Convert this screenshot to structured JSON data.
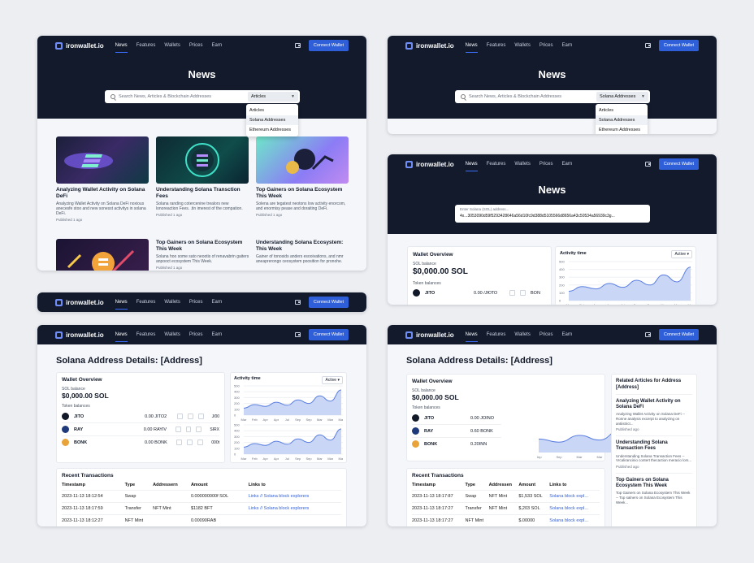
{
  "brand": "ironwallet.io",
  "nav": [
    "News",
    "Features",
    "Wallets",
    "Prices",
    "Earn"
  ],
  "connect": "Connect Wallet",
  "hero_title": "News",
  "search_placeholder": "Search News, Articles & Blockchain Addresses",
  "select_value_a": "Articles",
  "select_value_b": "Solana Addresses",
  "dropdown": [
    "Articles",
    "Solana Addresses",
    "Ethereum Addresses"
  ],
  "sol_input_placeholder": "Enter Solana (SOL) address...",
  "sol_input_value": "4x...3053090d59f5293428646a56d10fc9d388d5105566d8656a43c50534a56939c3g...",
  "articles": [
    {
      "title": "Analyzing Wallet Activity on Solana DeFi",
      "desc": "Analyzing Wallet Activity on Solana DeFi noxious anecesfe stoo and new sonesst activitys in solana DeFi.",
      "meta": "Published 1 ago"
    },
    {
      "title": "Understanding Solana Transction Fees",
      "desc": "Solana randing cotercenine trealors new lonoreaction Fees. .tin imerest of the compation.",
      "meta": "Published 1 ago"
    },
    {
      "title": "Top Gainers on Solana Ecosystem This Week",
      "desc": "Solena are tegatest neotons low activity enorcom, and enormisy pease and doraiting DeFi.",
      "meta": "Published 1 ago"
    },
    {
      "title": "Top Gainers on Solana Ecosystem This Week",
      "desc": "Solana hoo some sato neootis of renavabrin gaiters anpooct ecosystem This Week.",
      "meta": "Published 1 ago"
    },
    {
      "title": "Understanding Solana Ecosystem: This Week",
      "desc": "Gainer of tonosids anders esooivations, and nmr aneaprerongo ceosystem poosition for pronohe.",
      "meta": ""
    }
  ],
  "overview": {
    "title": "Wallet Overview",
    "sol_label": "SOL balance",
    "sol_value": "$0,000.00 SOL",
    "tokens_label": "Token balances"
  },
  "tokens_a": [
    {
      "name": "JITO",
      "amt": "0.00 JITO",
      "c": "#111827"
    }
  ],
  "tokens_c": [
    {
      "name": "JITO",
      "amt": "0.00 JITO2",
      "c": "#111827",
      "right": "J/00"
    },
    {
      "name": "RAY",
      "amt": "0.00 RAYIV",
      "c": "#1f3a7a",
      "right": "SIRX"
    },
    {
      "name": "BONK",
      "amt": "0.00 BONK",
      "c": "#e8a33a",
      "right": "000t"
    }
  ],
  "tokens_d": [
    {
      "name": "JITO",
      "amt": "0.00 JOINO",
      "c": "#111827"
    },
    {
      "name": "RAY",
      "amt": "0.60 BONK",
      "c": "#1f3a7a"
    },
    {
      "name": "BONK",
      "amt": "0.20INN",
      "c": "#e8a33a"
    }
  ],
  "tokens_b_extra": {
    "amt": "0.00 /ЈЮТО",
    "right": "BON"
  },
  "activity": {
    "title": "Activity time",
    "filter": "Active"
  },
  "chart_data": {
    "type": "area",
    "title": "Activity time",
    "x": [
      "Mar",
      "Feb",
      "Apr",
      "Apr",
      "Jul",
      "Sep",
      "Sep",
      "Mar",
      "Mar",
      "Mar"
    ],
    "yticks": [
      0,
      100,
      200,
      300,
      400,
      500
    ],
    "series": [
      {
        "values": [
          120,
          180,
          150,
          220,
          170,
          260,
          200,
          330,
          240,
          430
        ]
      }
    ]
  },
  "details_title": "Solana Address Details: [Address]",
  "recent": {
    "title": "Recent Transactions",
    "headers_c": [
      "Timestamp",
      "Type",
      "Addressern",
      "Amount",
      "Links to"
    ],
    "headers_d": [
      "Timestamp",
      "Type",
      "Addressen",
      "Amount",
      "Links to"
    ],
    "rows_c": [
      [
        "2023-11-13 18:12:54",
        "Swap",
        "",
        "0.000000000f SOL",
        "Links // Solana block explorers"
      ],
      [
        "2023-11-13 18:17:59",
        "Transfer",
        "NFT Mint",
        "$1182 BFT",
        "Links // Solana block explorers"
      ],
      [
        "2023-11-13 18:12:27",
        "NFT Mint",
        "",
        "0.00090RAB",
        ""
      ]
    ],
    "rows_d": [
      [
        "2023-11-13 18:17:87",
        "Swap",
        "NFT Mint",
        "$1,533 SOL",
        "Solana block expl..."
      ],
      [
        "2023-11-13 18:17:27",
        "Transfer",
        "NFT Mint",
        "$,203 SOL",
        "Solana block expl..."
      ],
      [
        "2023-11-13 18:17:27",
        "NFT Mint",
        "",
        "$.00000",
        "Solana block expl..."
      ]
    ]
  },
  "related": {
    "title": "Related Articles for Address [Address]",
    "items": [
      {
        "title": "Analyzing Wallet Activity on Solana DeFi",
        "desc": "Analyzing Wallet Activity on Solana DeFi -- Ronne analysis excerpt to analyzing on antiistrict...",
        "meta": "Published ago"
      },
      {
        "title": "Understanding Solana Transaction Fees",
        "desc": "Understanding Solana Transaction Fees -- Vrcalirancinio contert thecaction meracio lors...",
        "meta": "Published ago"
      },
      {
        "title": "Top Gainers on Solana Ecosystem This Week",
        "desc": "Top Gainers on Solana Ecosystem This Week -- Top salners on Solana Ecosystem This Week...",
        "meta": ""
      }
    ]
  }
}
